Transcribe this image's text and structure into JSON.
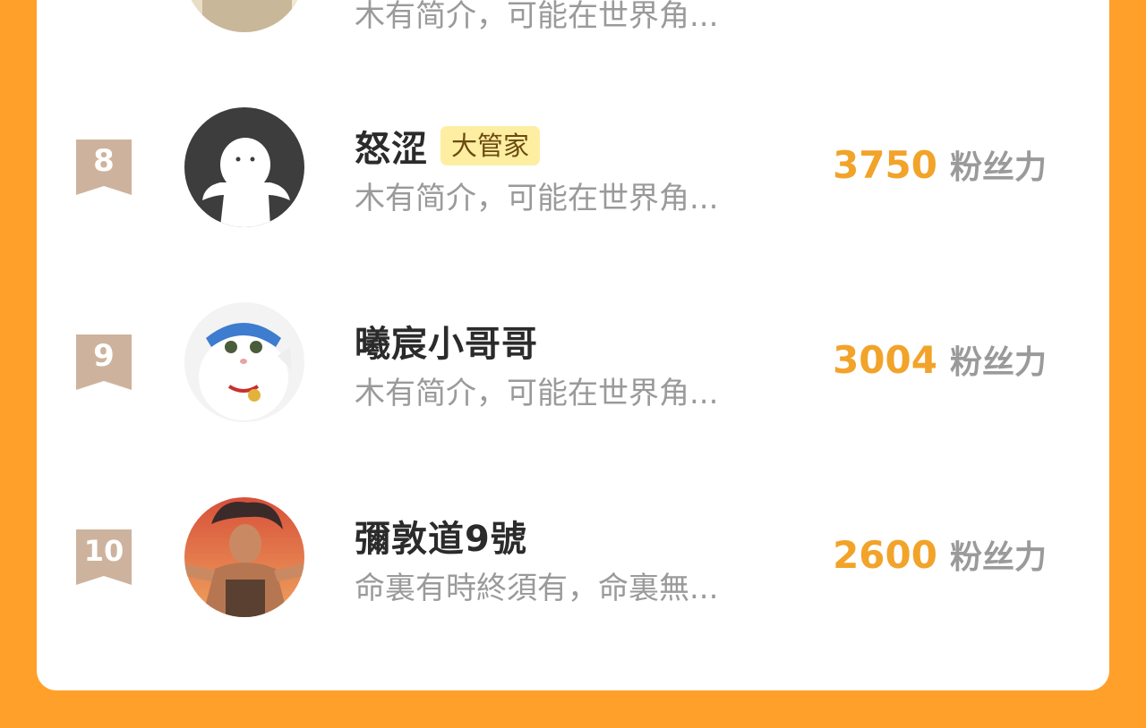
{
  "colors": {
    "background": "#ffa02a",
    "card": "#ffffff",
    "accent_value": "#f2a32a",
    "rank_ribbon": "#cdb39d",
    "badge_bg": "#fdeea2"
  },
  "partial_row": {
    "bio": "木有简介，可能在世界角..."
  },
  "rows": [
    {
      "rank": "8",
      "name": "怒涩",
      "badge": "大管家",
      "bio": "木有简介，可能在世界角...",
      "value": "3750",
      "unit": "粉丝力",
      "avatar_icon": "ghost-figure-avatar"
    },
    {
      "rank": "9",
      "name": "曦宸小哥哥",
      "badge": "",
      "bio": "木有简介，可能在世界角...",
      "value": "3004",
      "unit": "粉丝力",
      "avatar_icon": "white-cat-avatar"
    },
    {
      "rank": "10",
      "name": "彌敦道9號",
      "badge": "",
      "bio": "命裏有時終須有，命裏無...",
      "value": "2600",
      "unit": "粉丝力",
      "avatar_icon": "man-portrait-avatar"
    }
  ]
}
